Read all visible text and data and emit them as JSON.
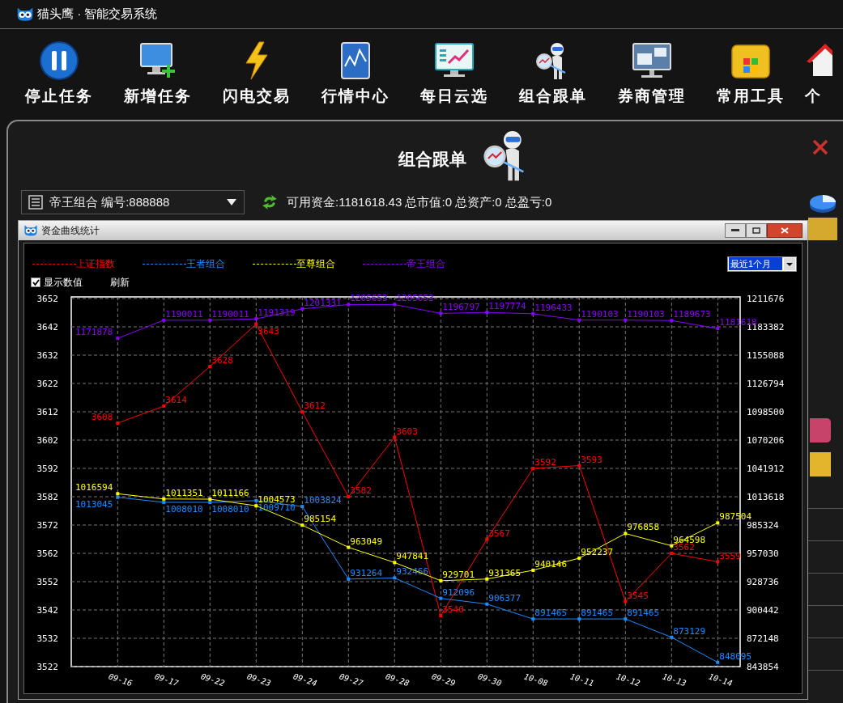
{
  "app": {
    "title": "猫头鹰 · 智能交易系统"
  },
  "toolbar": [
    {
      "label": "停止任务"
    },
    {
      "label": "新增任务"
    },
    {
      "label": "闪电交易"
    },
    {
      "label": "行情中心"
    },
    {
      "label": "每日云选"
    },
    {
      "label": "组合跟单"
    },
    {
      "label": "券商管理"
    },
    {
      "label": "常用工具"
    },
    {
      "label": "个"
    }
  ],
  "panel": {
    "title": "组合跟单",
    "portfolio_select": {
      "value": "帝王组合 编号:888888"
    },
    "summary": "可用资金:1181618.43 总市值:0 总资产:0 总盈亏:0"
  },
  "chart_window": {
    "title": "资金曲线统计",
    "range_select": {
      "value": "最近1个月"
    },
    "show_values": {
      "label": "显示数值",
      "checked": true
    },
    "refresh": "刷新",
    "chart_data": {
      "type": "line",
      "categories": [
        "09-16",
        "09-17",
        "09-22",
        "09-23",
        "09-24",
        "09-27",
        "09-28",
        "09-29",
        "09-30",
        "10-08",
        "10-11",
        "10-12",
        "10-13",
        "10-14"
      ],
      "series": [
        {
          "name": "上证指数",
          "color": "#ff0000",
          "marker": "square",
          "values": [
            3608,
            3614,
            3628,
            3643,
            3612,
            3582,
            3603,
            3540,
            3567,
            3592,
            3593,
            3545,
            3562,
            3559
          ]
        },
        {
          "name": "王者组合",
          "color": "#1e8cff",
          "axis": "y2",
          "marker": "square",
          "values": [
            1013045,
            1008010,
            1008010,
            1009710,
            1003824,
            931264,
            932466,
            912096,
            906377,
            891465,
            891465,
            891465,
            873129,
            848095
          ]
        },
        {
          "name": "至尊组合",
          "color": "#ffff00",
          "axis": "y2",
          "marker": "square",
          "values": [
            1016594,
            1011351,
            1011166,
            1004573,
            985154,
            963049,
            947841,
            929701,
            931365,
            940146,
            952237,
            976858,
            964598,
            987504
          ]
        },
        {
          "name": "帝王组合",
          "color": "#8a00ff",
          "axis": "y2",
          "marker": "square",
          "values": [
            1171878,
            1190011,
            1190011,
            1191319,
            1201331,
            1205653,
            1205653,
            1196797,
            1197774,
            1196433,
            1190103,
            1190103,
            1189673,
            1181618
          ]
        }
      ],
      "ylim": [
        3522,
        3652
      ],
      "yticks": [
        3652,
        3642,
        3632,
        3622,
        3612,
        3602,
        3592,
        3582,
        3572,
        3562,
        3552,
        3542,
        3532,
        3522
      ],
      "y2lim": [
        843854,
        1211676
      ],
      "y2ticks": [
        1211676,
        1183382,
        1155088,
        1126794,
        1098500,
        1070206,
        1041912,
        1013618,
        985324,
        957030,
        928736,
        900442,
        872148,
        843854
      ],
      "grid": true,
      "data_labels": true
    }
  }
}
